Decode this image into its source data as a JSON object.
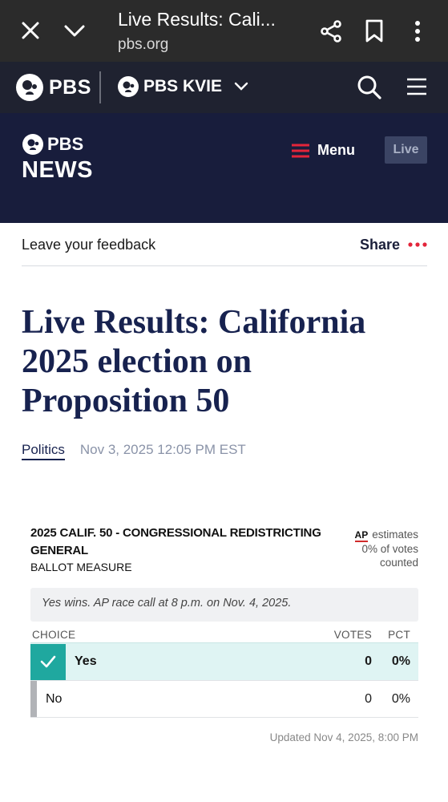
{
  "browser": {
    "title": "Live Results: Cali...",
    "url": "pbs.org"
  },
  "pbs_nav": {
    "logo": "PBS",
    "station": "PBS KVIE"
  },
  "news_header": {
    "logo_top": "PBS",
    "logo_bottom": "NEWS",
    "menu_label": "Menu",
    "live_label": "Live"
  },
  "feedback_bar": {
    "feedback_label": "Leave your feedback",
    "share_label": "Share"
  },
  "article": {
    "headline": "Live Results: California 2025 election on Proposition 50",
    "category": "Politics",
    "date": "Nov 3, 2025 12:05 PM EST"
  },
  "results": {
    "race_title": "2025 CALIF. 50 - CONGRESSIONAL REDISTRICTING GENERAL",
    "race_subtitle": "BALLOT MEASURE",
    "ap_logo": "AP",
    "ap_estimates": "estimates",
    "votes_counted": "0% of votes",
    "counted_label": "counted",
    "race_call": "Yes wins. AP race call at 8 p.m. on Nov. 4, 2025.",
    "columns": {
      "choice": "CHOICE",
      "votes": "VOTES",
      "pct": "PCT"
    },
    "rows": [
      {
        "name": "Yes",
        "votes": "0",
        "pct": "0%"
      },
      {
        "name": "No",
        "votes": "0",
        "pct": "0%"
      }
    ],
    "updated": "Updated Nov 4, 2025, 8:00 PM"
  },
  "colors": {
    "browser_bar": "#2b2b2b",
    "pbs_nav": "#1f2230",
    "news_header": "#181d3c",
    "headline": "#17224f",
    "winner_accent": "#1fa89f",
    "winner_row": "#dff4f3",
    "menu_accent": "#e3253a"
  }
}
